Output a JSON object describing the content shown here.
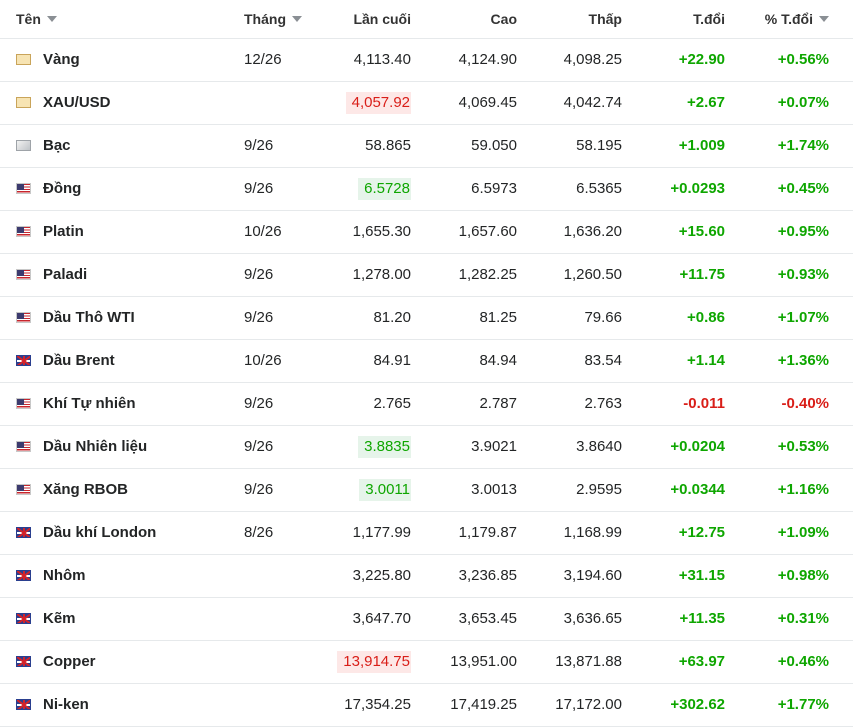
{
  "columns": {
    "name": "Tên",
    "month": "Tháng",
    "last": "Lần cuối",
    "high": "Cao",
    "low": "Thấp",
    "change": "T.đổi",
    "change_pct": "% T.đổi"
  },
  "rows": [
    {
      "flag": "gold",
      "name": "Vàng",
      "month": "12/26",
      "last": "4,113.40",
      "last_highlight": "",
      "high": "4,124.90",
      "low": "4,098.25",
      "change": "+22.90",
      "change_pct": "+0.56%",
      "direction": "up"
    },
    {
      "flag": "gold",
      "name": "XAU/USD",
      "month": "",
      "last": "4,057.92",
      "last_highlight": "down",
      "high": "4,069.45",
      "low": "4,042.74",
      "change": "+2.67",
      "change_pct": "+0.07%",
      "direction": "up"
    },
    {
      "flag": "silver",
      "name": "Bạc",
      "month": "9/26",
      "last": "58.865",
      "last_highlight": "",
      "high": "59.050",
      "low": "58.195",
      "change": "+1.009",
      "change_pct": "+1.74%",
      "direction": "up"
    },
    {
      "flag": "us",
      "name": "Đồng",
      "month": "9/26",
      "last": "6.5728",
      "last_highlight": "up",
      "high": "6.5973",
      "low": "6.5365",
      "change": "+0.0293",
      "change_pct": "+0.45%",
      "direction": "up"
    },
    {
      "flag": "us",
      "name": "Platin",
      "month": "10/26",
      "last": "1,655.30",
      "last_highlight": "",
      "high": "1,657.60",
      "low": "1,636.20",
      "change": "+15.60",
      "change_pct": "+0.95%",
      "direction": "up"
    },
    {
      "flag": "us",
      "name": "Paladi",
      "month": "9/26",
      "last": "1,278.00",
      "last_highlight": "",
      "high": "1,282.25",
      "low": "1,260.50",
      "change": "+11.75",
      "change_pct": "+0.93%",
      "direction": "up"
    },
    {
      "flag": "us",
      "name": "Dầu Thô WTI",
      "month": "9/26",
      "last": "81.20",
      "last_highlight": "",
      "high": "81.25",
      "low": "79.66",
      "change": "+0.86",
      "change_pct": "+1.07%",
      "direction": "up"
    },
    {
      "flag": "uk",
      "name": "Dầu Brent",
      "month": "10/26",
      "last": "84.91",
      "last_highlight": "",
      "high": "84.94",
      "low": "83.54",
      "change": "+1.14",
      "change_pct": "+1.36%",
      "direction": "up"
    },
    {
      "flag": "us",
      "name": "Khí Tự nhiên",
      "month": "9/26",
      "last": "2.765",
      "last_highlight": "",
      "high": "2.787",
      "low": "2.763",
      "change": "-0.011",
      "change_pct": "-0.40%",
      "direction": "down"
    },
    {
      "flag": "us",
      "name": "Dầu Nhiên liệu",
      "month": "9/26",
      "last": "3.8835",
      "last_highlight": "up",
      "high": "3.9021",
      "low": "3.8640",
      "change": "+0.0204",
      "change_pct": "+0.53%",
      "direction": "up"
    },
    {
      "flag": "us",
      "name": "Xăng RBOB",
      "month": "9/26",
      "last": "3.0011",
      "last_highlight": "up",
      "high": "3.0013",
      "low": "2.9595",
      "change": "+0.0344",
      "change_pct": "+1.16%",
      "direction": "up"
    },
    {
      "flag": "uk",
      "name": "Dầu khí London",
      "month": "8/26",
      "last": "1,177.99",
      "last_highlight": "",
      "high": "1,179.87",
      "low": "1,168.99",
      "change": "+12.75",
      "change_pct": "+1.09%",
      "direction": "up"
    },
    {
      "flag": "uk",
      "name": "Nhôm",
      "month": "",
      "last": "3,225.80",
      "last_highlight": "",
      "high": "3,236.85",
      "low": "3,194.60",
      "change": "+31.15",
      "change_pct": "+0.98%",
      "direction": "up"
    },
    {
      "flag": "uk",
      "name": "Kẽm",
      "month": "",
      "last": "3,647.70",
      "last_highlight": "",
      "high": "3,653.45",
      "low": "3,636.65",
      "change": "+11.35",
      "change_pct": "+0.31%",
      "direction": "up"
    },
    {
      "flag": "uk",
      "name": "Copper",
      "month": "",
      "last": "13,914.75",
      "last_highlight": "down",
      "high": "13,951.00",
      "low": "13,871.88",
      "change": "+63.97",
      "change_pct": "+0.46%",
      "direction": "up"
    },
    {
      "flag": "uk",
      "name": "Ni-ken",
      "month": "",
      "last": "17,354.25",
      "last_highlight": "",
      "high": "17,419.25",
      "low": "17,172.00",
      "change": "+302.62",
      "change_pct": "+1.77%",
      "direction": "up"
    }
  ]
}
